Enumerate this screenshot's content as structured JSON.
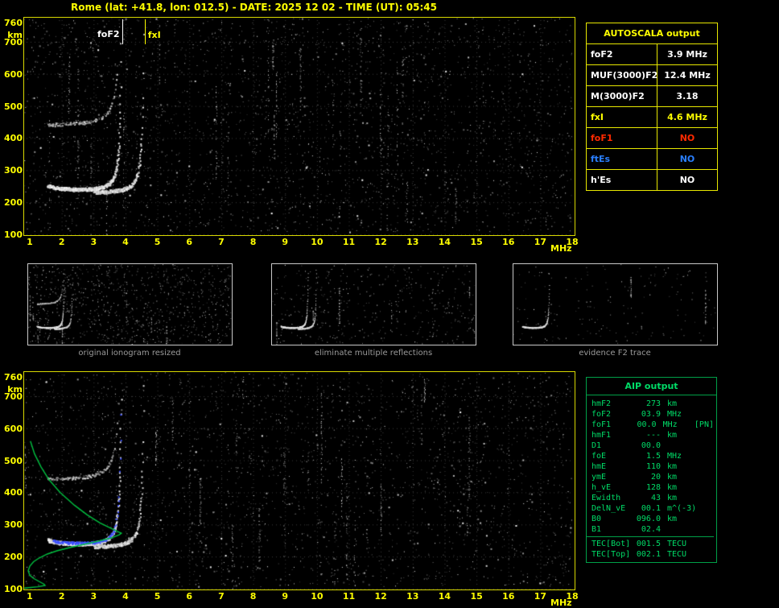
{
  "title": "Rome (lat: +41.8, lon: 012.5) - DATE: 2025 12 02 - TIME (UT): 05:45",
  "ionogram": {
    "y_unit": "km",
    "x_unit": "MHz",
    "y_ticks": [
      "760",
      "700",
      "600",
      "500",
      "400",
      "300",
      "200",
      "100"
    ],
    "x_ticks": [
      "1",
      "2",
      "3",
      "4",
      "5",
      "6",
      "7",
      "8",
      "9",
      "10",
      "11",
      "12",
      "13",
      "14",
      "15",
      "16",
      "17",
      "18"
    ],
    "fof2_label": "foF2",
    "fxi_label": "fxI",
    "fof2_mhz": 3.9,
    "fxi_mhz": 4.6
  },
  "autoscala": {
    "title": "AUTOSCALA output",
    "rows": [
      {
        "label": "foF2",
        "value": "3.9 MHz",
        "color": "#ffffff"
      },
      {
        "label": "MUF(3000)F2",
        "value": "12.4 MHz",
        "color": "#ffffff"
      },
      {
        "label": "M(3000)F2",
        "value": "3.18",
        "color": "#ffffff"
      },
      {
        "label": "fxI",
        "value": "4.6 MHz",
        "color": "#ffff00"
      },
      {
        "label": "foF1",
        "value": "NO",
        "color": "#ff2a00"
      },
      {
        "label": "ftEs",
        "value": "NO",
        "color": "#2a7fff"
      },
      {
        "label": "h'Es",
        "value": "NO",
        "color": "#ffffff"
      }
    ]
  },
  "thumbnails": [
    {
      "caption": "original ionogram resized"
    },
    {
      "caption": "eliminate multiple reflections"
    },
    {
      "caption": "evidence F2 trace"
    }
  ],
  "aip": {
    "title": "AIP output",
    "rows": [
      {
        "label": "hmF2",
        "value": "273",
        "unit": "km",
        "extra": ""
      },
      {
        "label": "foF2",
        "value": "03.9",
        "unit": "MHz",
        "extra": ""
      },
      {
        "label": "foF1",
        "value": "00.0",
        "unit": "MHz",
        "extra": "[PN]"
      },
      {
        "label": "hmF1",
        "value": "---",
        "unit": "km",
        "extra": ""
      },
      {
        "label": "D1",
        "value": "00.0",
        "unit": "",
        "extra": ""
      },
      {
        "label": "foE",
        "value": "1.5",
        "unit": "MHz",
        "extra": ""
      },
      {
        "label": "hmE",
        "value": "110",
        "unit": "km",
        "extra": ""
      },
      {
        "label": "ymE",
        "value": "20",
        "unit": "km",
        "extra": ""
      },
      {
        "label": "h_vE",
        "value": "128",
        "unit": "km",
        "extra": ""
      },
      {
        "label": "Ewidth",
        "value": "43",
        "unit": "km",
        "extra": ""
      },
      {
        "label": "DelN_vE",
        "value": "00.1",
        "unit": "m^(-3)",
        "extra": ""
      },
      {
        "label": "B0",
        "value": "096.0",
        "unit": "km",
        "extra": ""
      },
      {
        "label": "B1",
        "value": "02.4",
        "unit": "",
        "extra": ""
      }
    ],
    "tec_rows": [
      {
        "label": "TEC[Bot]",
        "value": "001.5",
        "unit": "TECU"
      },
      {
        "label": "TEC[Top]",
        "value": "002.1",
        "unit": "TECU"
      }
    ]
  },
  "colors": {
    "accent_yellow": "#ffff00",
    "accent_green": "#00db67",
    "trace_blue": "#3b4fff",
    "profile_green": "#00c040",
    "caption_gray": "#9a9a9a"
  }
}
